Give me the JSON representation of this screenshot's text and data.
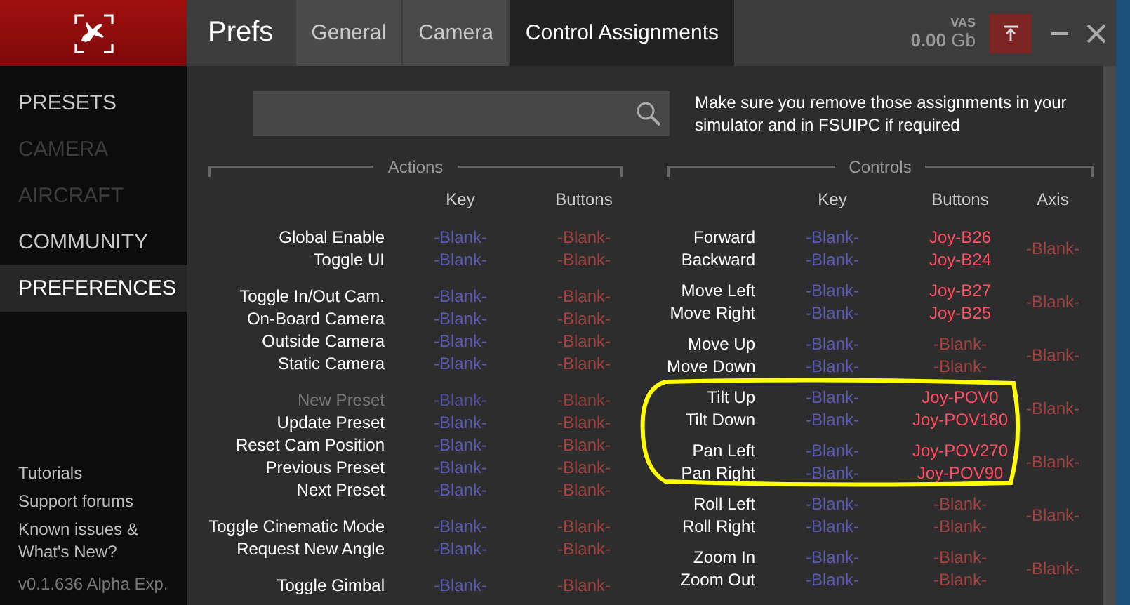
{
  "window": {
    "title": "Prefs"
  },
  "tabs": [
    {
      "label": "General",
      "selected": false
    },
    {
      "label": "Camera",
      "selected": false
    },
    {
      "label": "Control Assignments",
      "selected": true
    }
  ],
  "vas": {
    "label": "VAS",
    "value": "0.00",
    "unit": "Gb"
  },
  "sidebar": {
    "items": [
      {
        "label": "PRESETS",
        "selected": false,
        "disabled": false
      },
      {
        "label": "CAMERA",
        "selected": false,
        "disabled": true
      },
      {
        "label": "AIRCRAFT",
        "selected": false,
        "disabled": true
      },
      {
        "label": "COMMUNITY",
        "selected": false,
        "disabled": false
      },
      {
        "label": "PREFERENCES",
        "selected": true,
        "disabled": false
      }
    ],
    "links": [
      "Tutorials",
      "Support forums",
      "Known issues & What's New?"
    ],
    "version": "v0.1.636 Alpha Exp."
  },
  "note": "Make sure you remove those assignments in your simulator and in FSUIPC if required",
  "actions": {
    "title": "Actions",
    "columns": [
      "Key",
      "Buttons"
    ],
    "groups": [
      {
        "rows": [
          {
            "label": "Global Enable",
            "disabled": false,
            "key": "-Blank-",
            "buttons": {
              "text": "-Blank-",
              "assigned": false
            }
          },
          {
            "label": "Toggle UI",
            "disabled": false,
            "key": "-Blank-",
            "buttons": {
              "text": "-Blank-",
              "assigned": false
            }
          }
        ]
      },
      {
        "rows": [
          {
            "label": "Toggle In/Out Cam.",
            "disabled": false,
            "key": "-Blank-",
            "buttons": {
              "text": "-Blank-",
              "assigned": false
            }
          },
          {
            "label": "On-Board Camera",
            "disabled": false,
            "key": "-Blank-",
            "buttons": {
              "text": "-Blank-",
              "assigned": false
            }
          },
          {
            "label": "Outside Camera",
            "disabled": false,
            "key": "-Blank-",
            "buttons": {
              "text": "-Blank-",
              "assigned": false
            }
          },
          {
            "label": "Static Camera",
            "disabled": false,
            "key": "-Blank-",
            "buttons": {
              "text": "-Blank-",
              "assigned": false
            }
          }
        ]
      },
      {
        "rows": [
          {
            "label": "New Preset",
            "disabled": true,
            "key": "-Blank-",
            "buttons": {
              "text": "-Blank-",
              "assigned": false
            }
          },
          {
            "label": "Update Preset",
            "disabled": false,
            "key": "-Blank-",
            "buttons": {
              "text": "-Blank-",
              "assigned": false
            }
          },
          {
            "label": "Reset Cam Position",
            "disabled": false,
            "key": "-Blank-",
            "buttons": {
              "text": "-Blank-",
              "assigned": false
            }
          },
          {
            "label": "Previous Preset",
            "disabled": false,
            "key": "-Blank-",
            "buttons": {
              "text": "-Blank-",
              "assigned": false
            }
          },
          {
            "label": "Next Preset",
            "disabled": false,
            "key": "-Blank-",
            "buttons": {
              "text": "-Blank-",
              "assigned": false
            }
          }
        ]
      },
      {
        "rows": [
          {
            "label": "Toggle Cinematic Mode",
            "disabled": false,
            "key": "-Blank-",
            "buttons": {
              "text": "-Blank-",
              "assigned": false
            }
          },
          {
            "label": "Request New Angle",
            "disabled": false,
            "key": "-Blank-",
            "buttons": {
              "text": "-Blank-",
              "assigned": false
            }
          }
        ]
      },
      {
        "rows": [
          {
            "label": "Toggle Gimbal",
            "disabled": false,
            "key": "-Blank-",
            "buttons": {
              "text": "-Blank-",
              "assigned": false
            }
          }
        ]
      }
    ]
  },
  "controls": {
    "title": "Controls",
    "columns": [
      "Key",
      "Buttons",
      "Axis"
    ],
    "groups": [
      {
        "axis": "-Blank-",
        "rows": [
          {
            "label": "Forward",
            "key": "-Blank-",
            "buttons": {
              "text": "Joy-B26",
              "assigned": true
            }
          },
          {
            "label": "Backward",
            "key": "-Blank-",
            "buttons": {
              "text": "Joy-B24",
              "assigned": true
            }
          }
        ]
      },
      {
        "axis": "-Blank-",
        "rows": [
          {
            "label": "Move Left",
            "key": "-Blank-",
            "buttons": {
              "text": "Joy-B27",
              "assigned": true
            }
          },
          {
            "label": "Move Right",
            "key": "-Blank-",
            "buttons": {
              "text": "Joy-B25",
              "assigned": true
            }
          }
        ]
      },
      {
        "axis": "-Blank-",
        "rows": [
          {
            "label": "Move Up",
            "key": "-Blank-",
            "buttons": {
              "text": "-Blank-",
              "assigned": false
            }
          },
          {
            "label": "Move Down",
            "key": "-Blank-",
            "buttons": {
              "text": "-Blank-",
              "assigned": false
            }
          }
        ]
      },
      {
        "axis": "-Blank-",
        "rows": [
          {
            "label": "Tilt Up",
            "key": "-Blank-",
            "buttons": {
              "text": "Joy-POV0",
              "assigned": true
            }
          },
          {
            "label": "Tilt Down",
            "key": "-Blank-",
            "buttons": {
              "text": "Joy-POV180",
              "assigned": true
            }
          }
        ]
      },
      {
        "axis": "-Blank-",
        "rows": [
          {
            "label": "Pan Left",
            "key": "-Blank-",
            "buttons": {
              "text": "Joy-POV270",
              "assigned": true
            }
          },
          {
            "label": "Pan Right",
            "key": "-Blank-",
            "buttons": {
              "text": "Joy-POV90",
              "assigned": true
            }
          }
        ]
      },
      {
        "axis": "-Blank-",
        "rows": [
          {
            "label": "Roll Left",
            "key": "-Blank-",
            "buttons": {
              "text": "-Blank-",
              "assigned": false
            }
          },
          {
            "label": "Roll Right",
            "key": "-Blank-",
            "buttons": {
              "text": "-Blank-",
              "assigned": false
            }
          }
        ]
      },
      {
        "axis": "-Blank-",
        "rows": [
          {
            "label": "Zoom In",
            "key": "-Blank-",
            "buttons": {
              "text": "-Blank-",
              "assigned": false
            }
          },
          {
            "label": "Zoom Out",
            "key": "-Blank-",
            "buttons": {
              "text": "-Blank-",
              "assigned": false
            }
          }
        ]
      }
    ]
  }
}
